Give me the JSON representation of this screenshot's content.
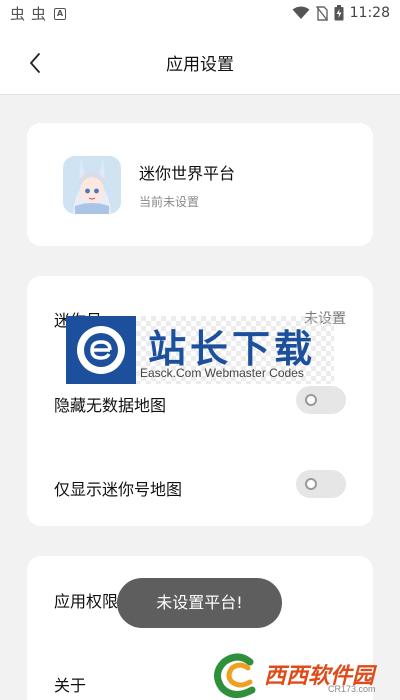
{
  "status_bar": {
    "time": "11:28",
    "left_icons": [
      "bug-icon",
      "bug-icon",
      "a-box-icon"
    ],
    "right_icons": [
      "wifi-icon",
      "no-sim-icon",
      "battery-charging-icon"
    ]
  },
  "nav": {
    "title": "应用设置",
    "back_icon": "chevron-left-icon"
  },
  "platform_card": {
    "title": "迷你世界平台",
    "subtitle": "当前未设置"
  },
  "map_settings": {
    "row1_label": "迷你号",
    "row1_value": "未设置",
    "row2_label": "隐藏无数据地图",
    "row2_on": false,
    "row3_label": "仅显示迷你号地图",
    "row3_on": false
  },
  "other_settings": {
    "permissions_label": "应用权限",
    "about_label": "关于"
  },
  "toast": {
    "message": "未设置平台!"
  },
  "watermark": {
    "cn_text": "站长下载",
    "en_text": "Easck.Com Webmaster Codes"
  },
  "corner_watermark": {
    "text": "西西软件园",
    "sub": "CR173.com"
  },
  "colors": {
    "background": "#f2f2f2",
    "card": "#ffffff",
    "toast_bg": "#5e5e5e",
    "toggle_off": "#e6e6e6",
    "watermark_blue": "#1c4f9c"
  }
}
